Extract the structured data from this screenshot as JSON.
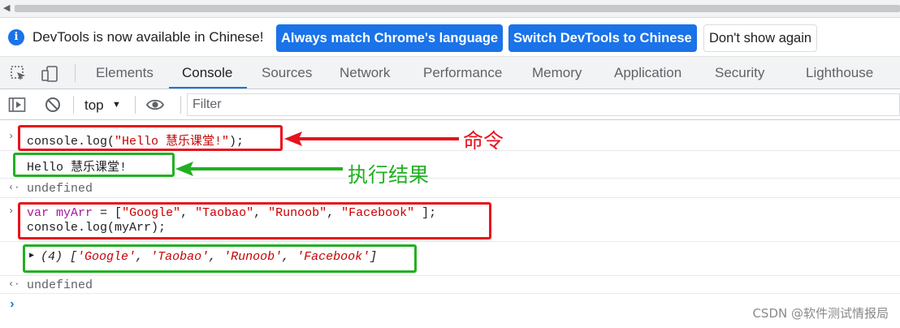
{
  "infobar": {
    "message": "DevTools is now available in Chinese!",
    "btn_match": "Always match Chrome's language",
    "btn_switch": "Switch DevTools to Chinese",
    "btn_dismiss": "Don't show again"
  },
  "tabs": [
    "Elements",
    "Console",
    "Sources",
    "Network",
    "Performance",
    "Memory",
    "Application",
    "Security",
    "Lighthouse"
  ],
  "active_tab": "Console",
  "console_toolbar": {
    "context": "top",
    "filter_placeholder": "Filter"
  },
  "console": {
    "cmd1": {
      "prefix": "console.log(",
      "string": "\"Hello 慧乐课堂!\"",
      "suffix": ");"
    },
    "out1": "Hello 慧乐课堂!",
    "undefined1": "undefined",
    "cmd2": {
      "kw": "var",
      "var": "myArr",
      "eq": " = [",
      "s1": "\"Google\"",
      "s2": "\"Taobao\"",
      "s3": "\"Runoob\"",
      "s4": "\"Facebook\"",
      "sep": ", ",
      "close": " ];",
      "line2_prefix": "console.log(",
      "line2_var": "myArr",
      "line2_suffix": ");"
    },
    "out2": {
      "count": "(4)",
      "open": "[",
      "items": [
        "'Google'",
        "'Taobao'",
        "'Runoob'",
        "'Facebook'"
      ],
      "close": "]"
    },
    "undefined2": "undefined"
  },
  "annotations": {
    "command": "命令",
    "result": "执行结果"
  },
  "colors": {
    "red": "#e8121c",
    "green": "#22b022",
    "accent": "#1a73e8"
  },
  "watermark": "CSDN @软件测试情报局"
}
